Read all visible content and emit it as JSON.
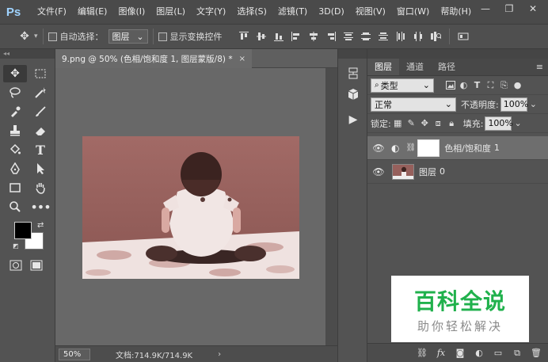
{
  "app": {
    "logo": "Ps"
  },
  "menu": [
    "文件(F)",
    "编辑(E)",
    "图像(I)",
    "图层(L)",
    "文字(Y)",
    "选择(S)",
    "滤镜(T)",
    "3D(D)",
    "视图(V)",
    "窗口(W)",
    "帮助(H)"
  ],
  "window_controls": {
    "minimize": "—",
    "restore": "❐",
    "close": "✕"
  },
  "options_bar": {
    "auto_select_label": "自动选择：",
    "auto_select_target": "图层",
    "show_transform_label": "显示变换控件"
  },
  "document": {
    "tab_title": "9.png @ 50% (色相/饱和度 1, 图层蒙版/8) *",
    "close_glyph": "×",
    "zoom": "50%",
    "doc_info": "文档:714.9K/714.9K",
    "status_arrow": "›"
  },
  "layers_panel": {
    "tabs": [
      "图层",
      "通道",
      "路径"
    ],
    "active_tab": "图层",
    "filter_kind": "类型",
    "blend_mode": "正常",
    "opacity_label": "不透明度:",
    "opacity": "100%",
    "lock_label": "锁定:",
    "fill_label": "填充:",
    "fill": "100%",
    "layers": [
      {
        "name": "色相/饱和度",
        "suffix": "1",
        "selected": true,
        "type": "adjustment"
      },
      {
        "name": "图层",
        "suffix": "0",
        "selected": false,
        "type": "pixel"
      }
    ]
  },
  "watermark": {
    "main": "百科全说",
    "sub": "助你轻松解决"
  },
  "colors": {
    "foreground": "#000000",
    "background": "#ffffff",
    "watermark_green": "#20b14c"
  }
}
